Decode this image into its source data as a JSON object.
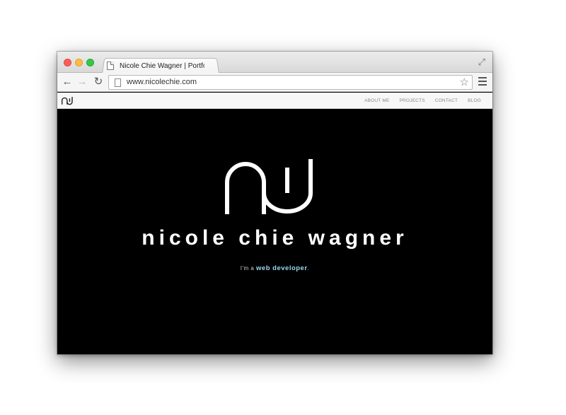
{
  "browser": {
    "tab_title": "Nicole Chie Wagner | Portfolio",
    "url": "www.nicolechie.com"
  },
  "site": {
    "nav": [
      "ABOUT ME",
      "PROJECTS",
      "CONTACT",
      "BLOG"
    ],
    "hero": {
      "name": "nicole chie wagner",
      "tagline_prefix": "I'm a",
      "tagline_highlight": "web developer",
      "tagline_suffix": "."
    }
  },
  "colors": {
    "hero_background": "#000000",
    "highlight": "#9ed7ee"
  },
  "icons": [
    "page-icon",
    "back-arrow-icon",
    "forward-arrow-icon",
    "reload-icon",
    "star-icon",
    "menu-icon",
    "fullscreen-icon"
  ]
}
